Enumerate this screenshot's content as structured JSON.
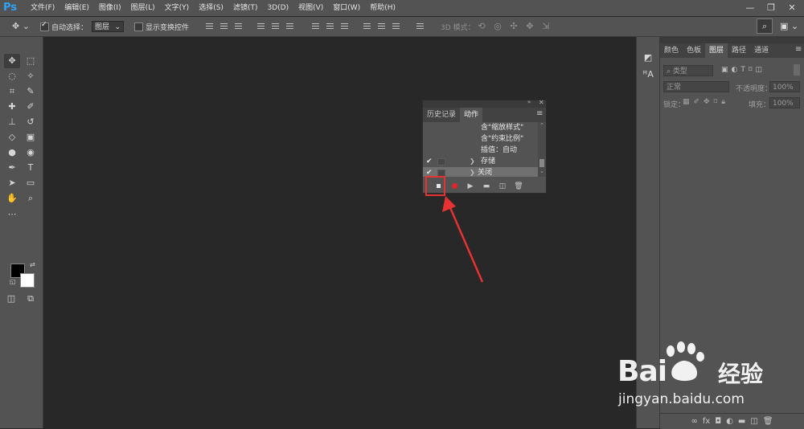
{
  "app": {
    "logo": "Ps"
  },
  "menu": [
    "文件(F)",
    "编辑(E)",
    "图像(I)",
    "图层(L)",
    "文字(Y)",
    "选择(S)",
    "滤镜(T)",
    "3D(D)",
    "视图(V)",
    "窗口(W)",
    "帮助(H)"
  ],
  "window_controls": {
    "minimize": "—",
    "restore": "❐",
    "close": "✕"
  },
  "options_bar": {
    "auto_select_label": "自动选择：",
    "auto_select_checked": true,
    "auto_select_value": "图层",
    "show_transform_label": "显示变换控件",
    "show_transform_checked": false,
    "mode_3d_label": "3D 模式："
  },
  "right_panel": {
    "tabs": [
      "颜色",
      "色板",
      "图层",
      "路径",
      "通道"
    ],
    "active_tab": "图层",
    "filter_placeholder": "类型",
    "blend_mode": "正常",
    "opacity_label": "不透明度：",
    "opacity_value": "100%",
    "lock_label": "锁定：",
    "fill_label": "填充：",
    "fill_value": "100%"
  },
  "actions_panel": {
    "tabs": [
      "历史记录",
      "动作"
    ],
    "active_tab": "动作",
    "rows": [
      {
        "text": "含\"缩放样式\"",
        "checked": false,
        "expandable": false,
        "selected": false
      },
      {
        "text": "含\"约束比例\"",
        "checked": false,
        "expandable": false,
        "selected": false
      },
      {
        "text": "插值：自动",
        "checked": false,
        "expandable": false,
        "selected": false
      },
      {
        "text": "存储",
        "checked": true,
        "expandable": true,
        "selected": false
      },
      {
        "text": "关闭",
        "checked": true,
        "expandable": true,
        "selected": true
      }
    ],
    "toolbar_buttons": [
      "stop",
      "record",
      "play",
      "new-set",
      "new-action",
      "delete"
    ]
  },
  "watermark": {
    "brand_left": "Bai",
    "brand_right": "经验",
    "url": "jingyan.baidu.com"
  },
  "colors": {
    "annotation_red": "#e63232",
    "record_red": "#e0262a",
    "ps_blue": "#2fa3f6"
  }
}
